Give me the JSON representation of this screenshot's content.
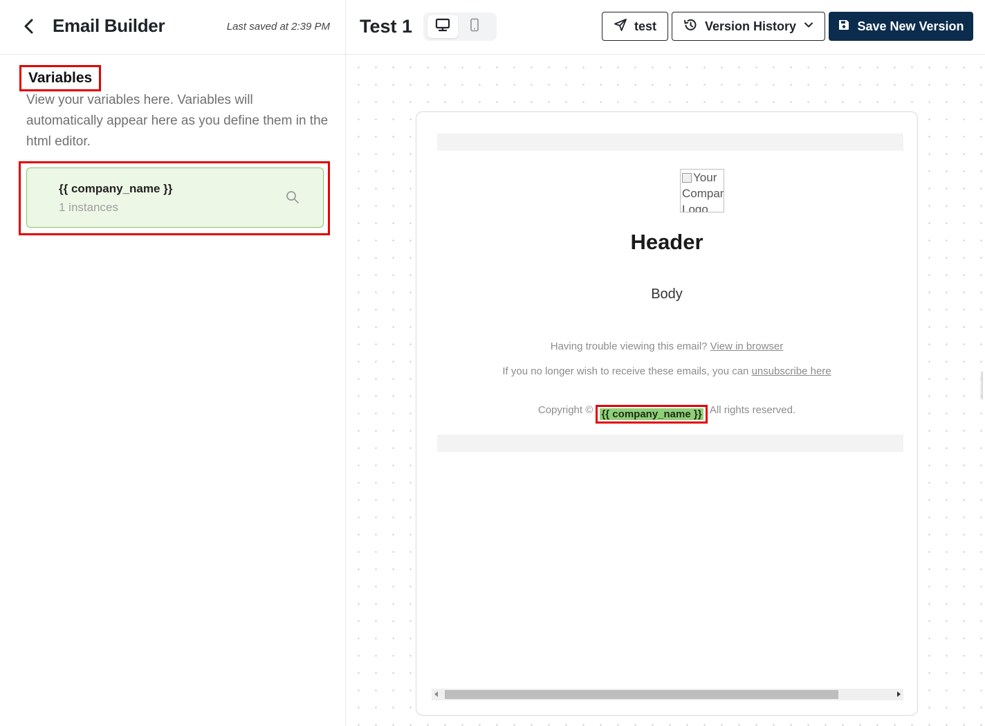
{
  "sidebar": {
    "back_icon": "chevron-left-icon",
    "title": "Email Builder",
    "last_saved": "Last saved at 2:39 PM",
    "variables_heading": "Variables",
    "variables_description": "View your variables here. Variables will automatically appear here as you define them in the html editor.",
    "variables": [
      {
        "name": "{{ company_name }}",
        "instances": "1 instances",
        "icon": "search-icon"
      }
    ]
  },
  "topbar": {
    "doc_title": "Test 1",
    "device_toggle": {
      "desktop_icon": "desktop-icon",
      "mobile_icon": "mobile-icon",
      "selected": "desktop"
    },
    "test_button": {
      "label": "test",
      "icon": "send-icon"
    },
    "version_history_button": {
      "label": "Version History",
      "icon": "history-icon",
      "caret": "chevron-down-icon"
    },
    "save_button": {
      "label": "Save New Version",
      "icon": "save-icon"
    }
  },
  "email": {
    "logo_alt": "Your Company Logo",
    "header": "Header",
    "body": "Body",
    "footer": {
      "trouble_text": "Having trouble viewing this email? ",
      "view_in_browser": "View in browser",
      "unsubscribe_text": "If you no longer wish to receive these emails, you can ",
      "unsubscribe_link": "unsubscribe here",
      "copyright_prefix": "Copyright © ",
      "copyright_variable": "{{ company_name }}",
      "copyright_suffix": " All rights reserved."
    }
  },
  "colors": {
    "highlight_outline": "#e30000",
    "variable_card_bg": "#edf7e6",
    "variable_card_border": "#86c46b",
    "variable_chip": "#8fd07a",
    "save_button_bg": "#0c2c4d"
  }
}
